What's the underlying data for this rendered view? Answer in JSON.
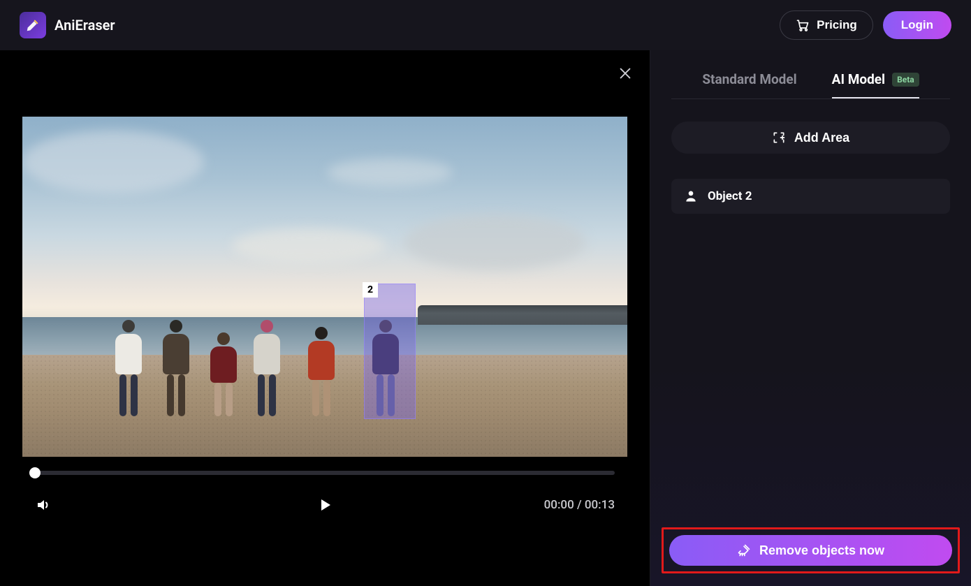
{
  "header": {
    "brand": "AniEraser",
    "pricing_label": "Pricing",
    "login_label": "Login"
  },
  "video": {
    "selection_tag": "2",
    "time_current": "00:00",
    "time_separator": " / ",
    "time_total": "00:13"
  },
  "side": {
    "tabs": {
      "standard": "Standard Model",
      "ai": "AI Model",
      "beta_label": "Beta",
      "active": "ai"
    },
    "add_area_label": "Add Area",
    "objects": [
      {
        "label": "Object 2"
      }
    ],
    "remove_label": "Remove objects now"
  },
  "colors": {
    "accent_start": "#8a5cf6",
    "accent_end": "#c04bf0",
    "highlight": "#e11a1a"
  }
}
